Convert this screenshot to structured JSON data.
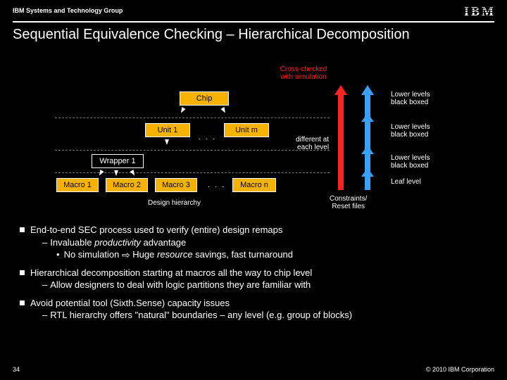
{
  "header": {
    "org": "IBM Systems and Technology Group",
    "logo": "IBM"
  },
  "title": "Sequential Equivalence Checking – Hierarchical Decomposition",
  "diagram": {
    "cross_checked": "Cross-checked\nwith simulation",
    "chip": "Chip",
    "unit1": "Unit 1",
    "unitm": "Unit m",
    "wrapper": "Wrapper 1",
    "macro1": "Macro 1",
    "macro2": "Macro 2",
    "macro3": "Macro 3",
    "macron": "Macro n",
    "hierarchy_caption": "Design hierarchy",
    "different": "different at\neach level",
    "constraints": "Constraints/\nReset files",
    "level_chip": "Lower levels\nblack boxed",
    "level_unit": "Lower levels\nblack boxed",
    "level_wrapper": "Lower levels\nblack boxed",
    "level_leaf": "Leaf level"
  },
  "bullets": {
    "b1": "End-to-end SEC process used to verify (entire) design remaps",
    "b1a_pre": "Invaluable ",
    "b1a_em": "productivity",
    "b1a_post": " advantage",
    "b1b_pre": "No simulation ",
    "b1b_post1": " Huge ",
    "b1b_em": "resource",
    "b1b_post2": " savings, fast turnaround",
    "b2": "Hierarchical decomposition starting at macros all the way to chip level",
    "b2a": "Allow designers to deal with logic partitions they are familiar with",
    "b3": "Avoid potential tool (Sixth.Sense) capacity issues",
    "b3a": "RTL hierarchy offers \"natural\" boundaries – any level (e.g. group of blocks)"
  },
  "footer": {
    "page": "34",
    "copyright": "© 2010 IBM Corporation"
  },
  "glyph": {
    "arrow": "⇨"
  }
}
